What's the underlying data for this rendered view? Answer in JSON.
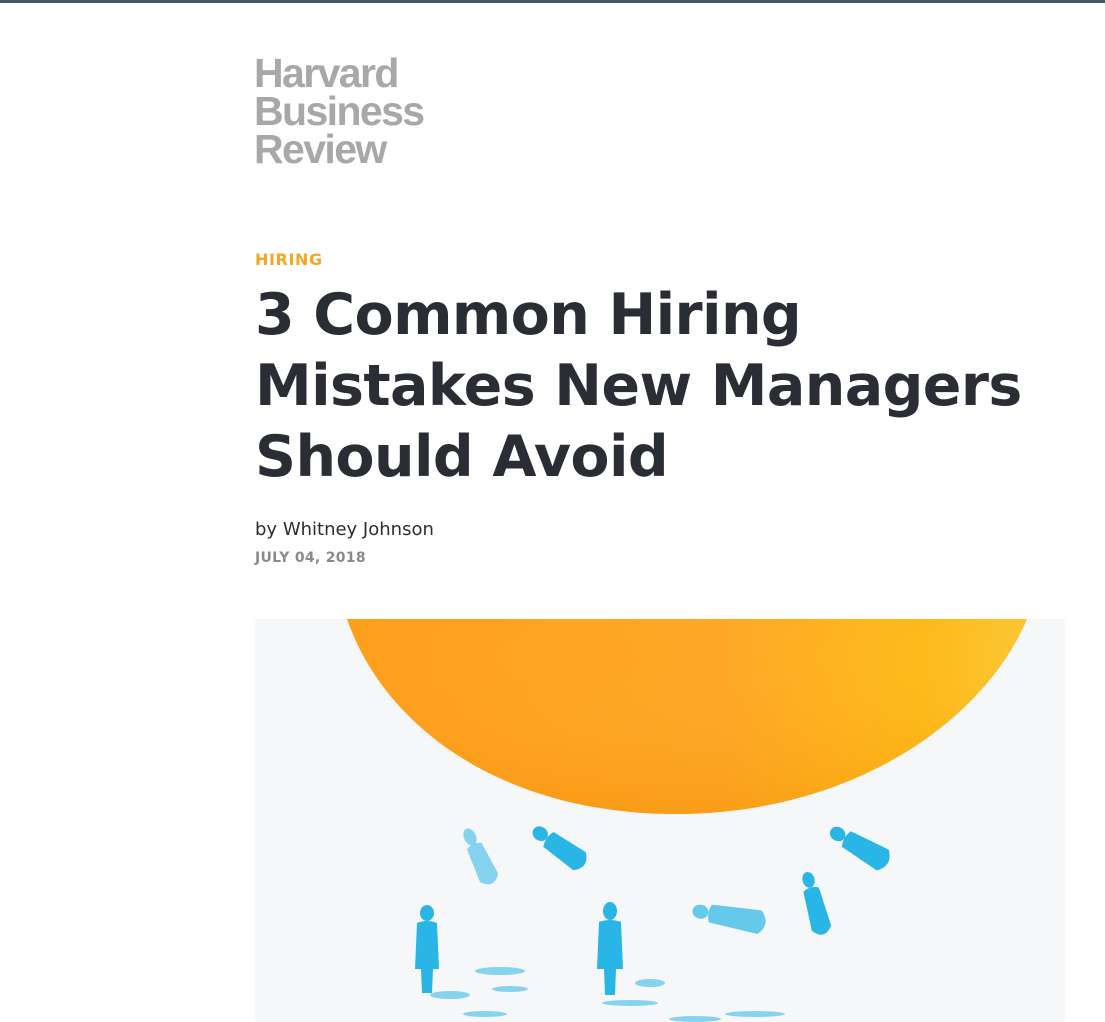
{
  "masthead": {
    "logo_line1": "Harvard",
    "logo_line2": "Business",
    "logo_line3": "Review"
  },
  "article": {
    "topic": "HIRING",
    "title": "3 Common Hiring Mistakes New Managers Should Avoid",
    "byline_prefix": "by",
    "author": "Whitney Johnson",
    "date": "JULY 04, 2018"
  },
  "hero": {
    "icon": "hero-illustration",
    "sphere_color": "#ffa726",
    "figure_color": "#29b6e6"
  },
  "colors": {
    "topic": "#f5a623",
    "headline": "#2a2d34",
    "date": "#8a8a8a",
    "top_rule": "#4a5560"
  }
}
